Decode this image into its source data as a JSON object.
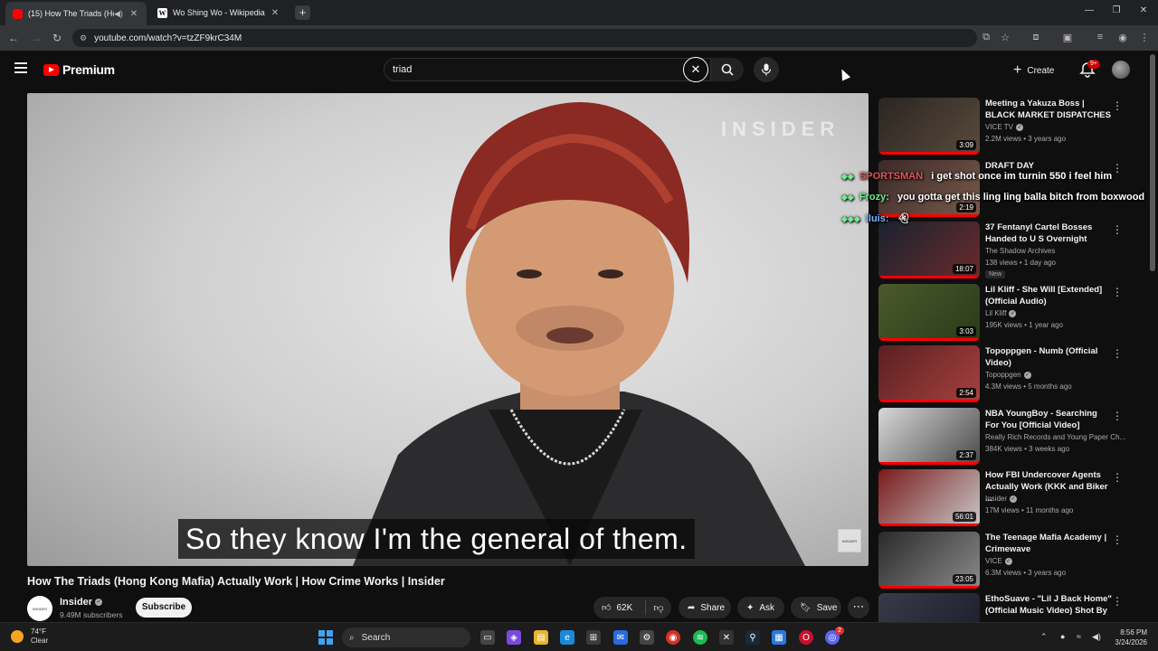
{
  "browser": {
    "tabs": [
      {
        "title": "(15) How The Triads (Hong Kong Mafia) Actually Work | How Crime Works | Insider - YouTube",
        "active": true
      },
      {
        "title": "Wo Shing Wo - Wikipedia",
        "active": false
      }
    ],
    "new_tab": "+",
    "url": "youtube.com/watch?v=tzZF9krC34M"
  },
  "youtube": {
    "logo_text": "Premium",
    "search_value": "triad",
    "create_label": "Create",
    "notification_count": "9+"
  },
  "video": {
    "watermark": "INSIDER",
    "caption": "So they know I'm the general of them.",
    "corner_brand": "INSIDER",
    "title": "How The Triads (Hong Kong Mafia) Actually Work | How Crime Works | Insider",
    "channel": "Insider",
    "subscribers": "9.49M subscribers",
    "subscribe_label": "Subscribe",
    "likes": "62K",
    "share_label": "Share",
    "ask_label": "Ask",
    "save_label": "Save"
  },
  "recommendations": [
    {
      "title": "Meeting a Yakuza Boss | BLACK MARKET DISPATCHES",
      "channel": "VICE TV",
      "verified": true,
      "meta": "2.2M views • 3 years ago",
      "duration": "3:09",
      "colors": [
        "#2a2622",
        "#5a4a3c"
      ]
    },
    {
      "title": "DRAFT DAY",
      "channel": "",
      "verified": false,
      "meta": "",
      "duration": "2:19",
      "colors": [
        "#3a2a2a",
        "#7a5a4a"
      ]
    },
    {
      "title": "37 Fentanyl Cartel Bosses Handed to U S Overnight",
      "channel": "The Shadow Archives",
      "verified": false,
      "meta": "138 views • 1 day ago",
      "badge": "New",
      "duration": "18:07",
      "colors": [
        "#1a2230",
        "#6a2a2a"
      ]
    },
    {
      "title": "Lil Kliff - She Will [Extended] (Official Audio)",
      "channel": "Lil Kliff",
      "verified": true,
      "meta": "195K views • 1 year ago",
      "duration": "3:03",
      "colors": [
        "#4a5a2a",
        "#2a3a1a"
      ]
    },
    {
      "title": "Topoppgen - Numb (Official Video)",
      "channel": "Topoppgen",
      "verified": true,
      "meta": "4.3M views • 5 months ago",
      "duration": "2:54",
      "colors": [
        "#5a2020",
        "#a84040"
      ]
    },
    {
      "title": "NBA YoungBoy - Searching For You [Official Video]",
      "channel": "Really Rich Records and Young Paper Ch...",
      "verified": false,
      "meta": "384K views • 3 weeks ago",
      "duration": "2:37",
      "colors": [
        "#d8d8d8",
        "#4a4a4a"
      ]
    },
    {
      "title": "How FBI Undercover Agents Actually Work (KKK and Biker ...",
      "channel": "Insider",
      "verified": true,
      "meta": "17M views • 11 months ago",
      "duration": "56:01",
      "colors": [
        "#7a1a1a",
        "#c8c8c8"
      ]
    },
    {
      "title": "The Teenage Mafia Academy | Crimewave",
      "channel": "VICE",
      "verified": true,
      "meta": "6.3M views • 3 years ago",
      "duration": "23:05",
      "colors": [
        "#2a2a2a",
        "#8a8a8a"
      ]
    },
    {
      "title": "EthoSuave - \"Lil J Back Home\" (Official Music Video) Shot By ...",
      "channel": "",
      "verified": false,
      "meta": "",
      "duration": "",
      "colors": [
        "#3a3a4a",
        "#1a1a2a"
      ]
    }
  ],
  "chat": [
    {
      "user": "SPORTSMAN",
      "message": "i get shot once im turnin 550 i feel him"
    },
    {
      "user": "Frozy:",
      "message": "you gotta get this ling ling balla bitch from boxwood"
    },
    {
      "user": "lluis:",
      "message": ""
    }
  ],
  "taskbar": {
    "temperature": "74°F",
    "condition": "Clear",
    "search_label": "Search",
    "time": "8:56 PM",
    "date": "3/24/2026",
    "discord_badge": "2"
  }
}
